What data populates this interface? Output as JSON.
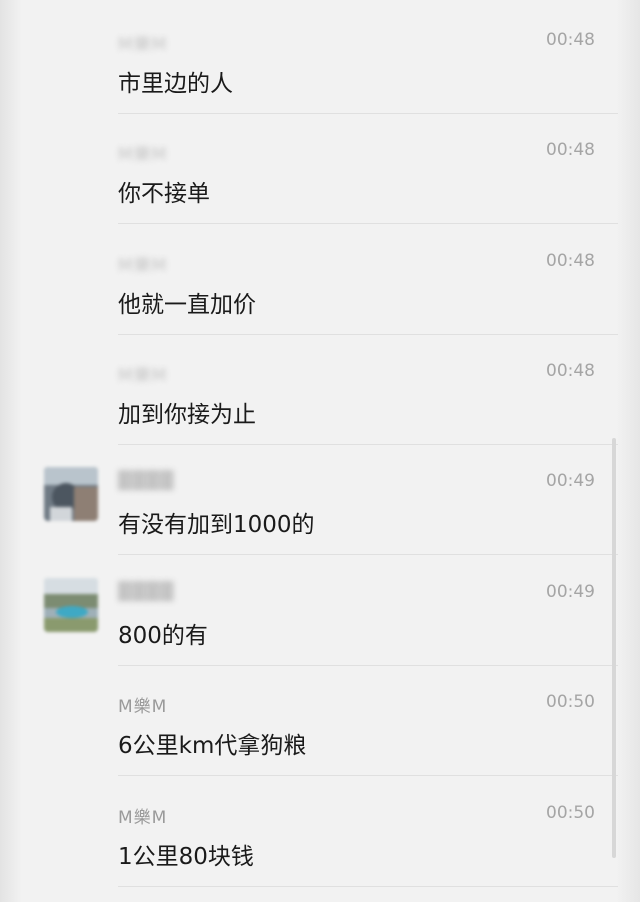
{
  "messages": [
    {
      "sender": "M樂M",
      "sender_blurred": true,
      "time": "00:48",
      "text": "市里边的人",
      "avatar": false
    },
    {
      "sender": "M樂M",
      "sender_blurred": true,
      "time": "00:48",
      "text": "你不接单",
      "avatar": false
    },
    {
      "sender": "M樂M",
      "sender_blurred": true,
      "time": "00:48",
      "text": "他就一直加价",
      "avatar": false
    },
    {
      "sender": "M樂M",
      "sender_blurred": true,
      "time": "00:48",
      "text": "加到你接为止",
      "avatar": false
    },
    {
      "sender": "",
      "sender_blurred": true,
      "time": "00:49",
      "text": "有没有加到1000的",
      "avatar": true
    },
    {
      "sender": "",
      "sender_blurred": true,
      "time": "00:49",
      "text": "800的有",
      "avatar": true
    },
    {
      "sender": "M樂M",
      "sender_blurred": false,
      "time": "00:50",
      "text": "6公里km代拿狗粮",
      "avatar": false
    },
    {
      "sender": "M樂M",
      "sender_blurred": false,
      "time": "00:50",
      "text": "1公里80块钱",
      "avatar": false
    }
  ],
  "colors": {
    "background": "#f2f2f2",
    "text": "#1a1a1a",
    "meta": "#9a9a9a",
    "divider": "#e0e0e0"
  }
}
